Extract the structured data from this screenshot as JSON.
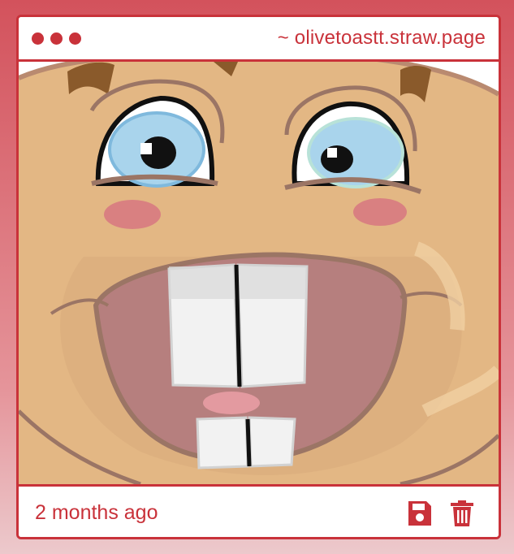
{
  "window": {
    "site": "~ olivetoastt.straw.page",
    "control_dots": [
      "dot",
      "dot",
      "dot"
    ]
  },
  "post": {
    "timestamp": "2 months ago",
    "actions": [
      {
        "name": "save",
        "icon": "floppy-disk-icon"
      },
      {
        "name": "delete",
        "icon": "trash-can-icon"
      }
    ]
  },
  "colors": {
    "accent": "#c9323a",
    "background_top": "#d3525c",
    "background_bottom": "#ecc9cc",
    "skin": "#e3b784",
    "mouth": "#b67f7e",
    "teeth": "#f2f2f2",
    "iris": "#a9d4ec",
    "cheek": "#d98081",
    "hair": "#8a5a2b"
  }
}
